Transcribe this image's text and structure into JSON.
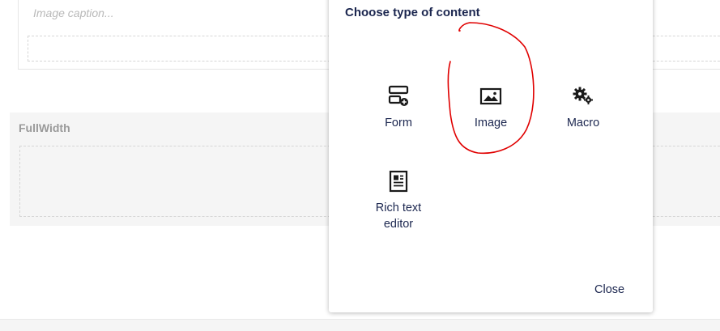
{
  "editor": {
    "caption_placeholder": "Image caption...",
    "fullwidth_title": "FullWidth"
  },
  "dialog": {
    "title": "Choose type of content",
    "options": [
      {
        "label": "Form",
        "icon": "form-icon"
      },
      {
        "label": "Image",
        "icon": "image-icon"
      },
      {
        "label": "Macro",
        "icon": "gears-icon"
      },
      {
        "label": "Rich text editor",
        "icon": "document-icon"
      }
    ],
    "close_label": "Close"
  },
  "annotation": {
    "color": "#e00000",
    "highlights": "Image"
  },
  "colors": {
    "text": "#1b264f",
    "muted": "#9a9a9a",
    "panel": "#f5f5f5"
  }
}
